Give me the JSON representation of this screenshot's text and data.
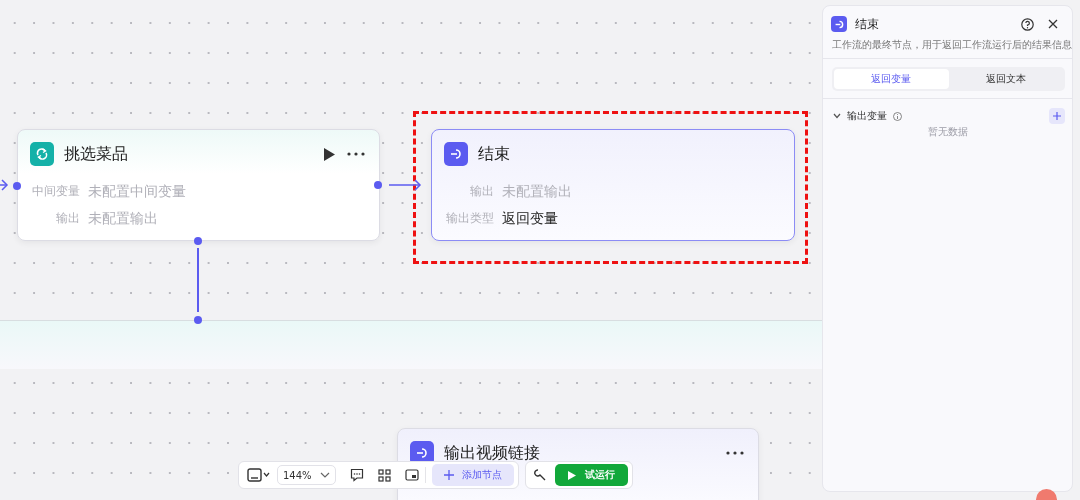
{
  "nodes": [
    {
      "kind": "loop",
      "title": "挑选菜品",
      "selected": false,
      "fields": [
        {
          "label": "中间变量",
          "value": "未配置中间变量",
          "configured": false
        },
        {
          "label": "输出",
          "value": "未配置输出",
          "configured": false
        }
      ]
    },
    {
      "kind": "end",
      "title": "结束",
      "selected": true,
      "fields": [
        {
          "label": "输出",
          "value": "未配置输出",
          "configured": false
        },
        {
          "label": "输出类型",
          "value": "返回变量",
          "configured": true
        }
      ]
    },
    {
      "kind": "output",
      "title": "输出视频链接",
      "selected": false
    }
  ],
  "panel": {
    "kind": "end",
    "title": "结束",
    "description": "工作流的最终节点，用于返回工作流运行后的结果信息",
    "tabs": [
      {
        "label": "返回变量",
        "selected": true
      },
      {
        "label": "返回文本",
        "selected": false
      }
    ],
    "section": {
      "title": "输出变量",
      "expanded": true,
      "empty_text": "暂无数据"
    }
  },
  "toolbar": {
    "zoom": "144%",
    "add_button": "添加节点",
    "run_button": "试运行"
  }
}
